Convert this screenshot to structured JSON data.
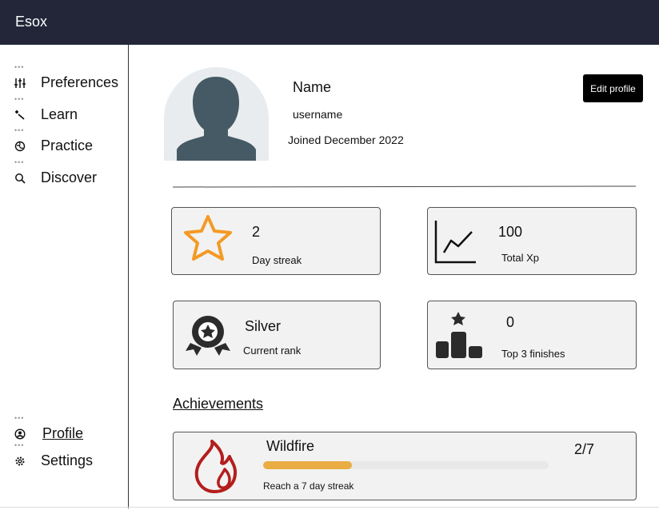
{
  "app": {
    "title": "Esox"
  },
  "sidebar": {
    "items": [
      {
        "label": "Preferences",
        "icon": "sliders-icon"
      },
      {
        "label": "Learn",
        "icon": "wand-icon"
      },
      {
        "label": "Practice",
        "icon": "globe-icon"
      },
      {
        "label": "Discover",
        "icon": "search-icon"
      }
    ],
    "bottom_items": [
      {
        "label": "Profile",
        "icon": "user-circle-icon"
      },
      {
        "label": "Settings",
        "icon": "gear-icon"
      }
    ]
  },
  "profile": {
    "name": "Name",
    "username": "username",
    "joined": "Joined December 2022",
    "edit_label": "Edit profile"
  },
  "stats": {
    "streak": {
      "value": "2",
      "label": "Day streak"
    },
    "xp": {
      "value": "100",
      "label": "Total Xp"
    },
    "rank": {
      "value": "Silver",
      "label": "Current rank"
    },
    "finishes": {
      "value": "0",
      "label": "Top 3 finishes"
    }
  },
  "achievements": {
    "title": "Achievements",
    "items": [
      {
        "name": "Wildfire",
        "progress": "2/7",
        "progress_fraction": 0.31,
        "description": "Reach a 7 day streak"
      }
    ]
  },
  "colors": {
    "topbar": "#222638",
    "star": "#f39a26",
    "flame": "#b51d1d",
    "progress": "#e9ad43",
    "avatar": "#455a64"
  }
}
